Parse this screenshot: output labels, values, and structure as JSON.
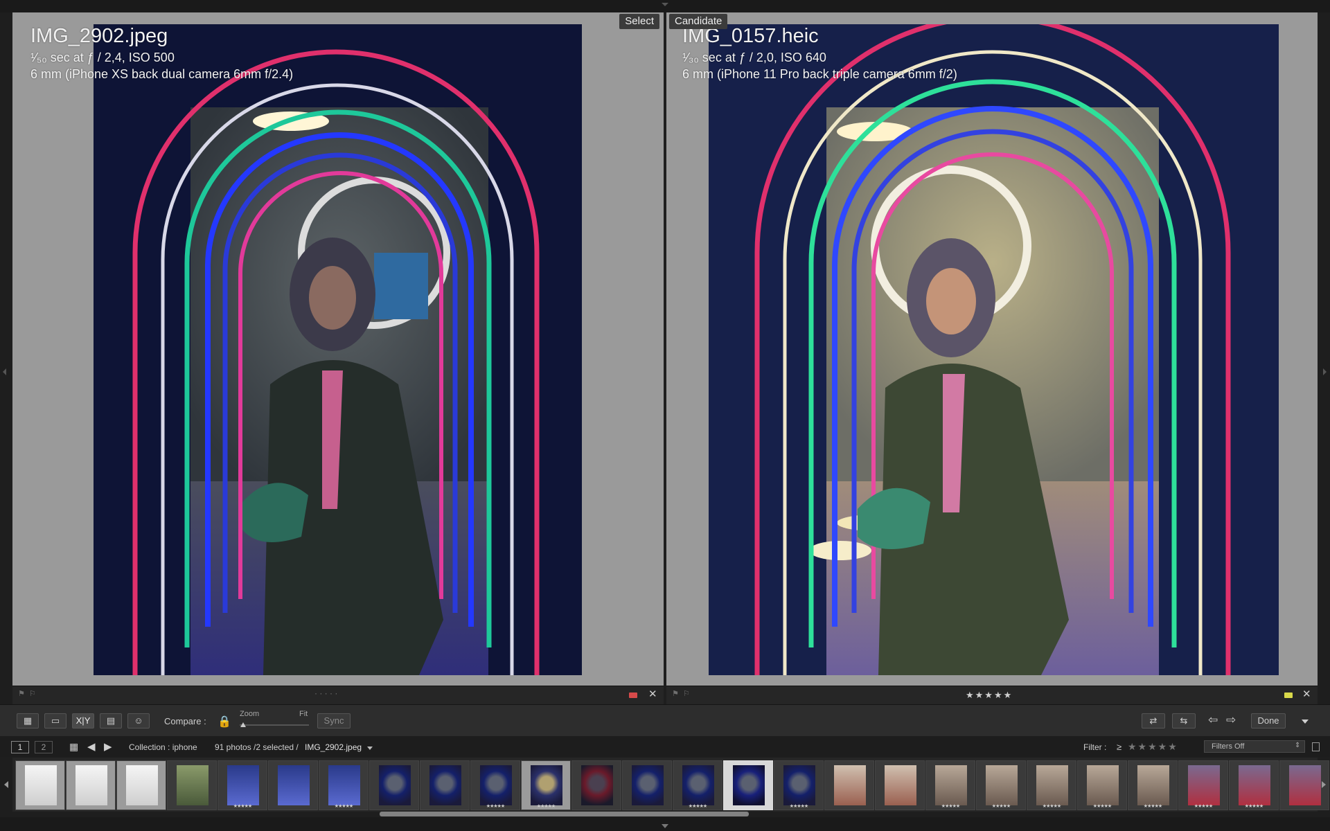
{
  "compare": {
    "left": {
      "tag": "Select",
      "filename": "IMG_2902.jpeg",
      "exposure": "¹⁄₅₀ sec at ƒ / 2,4, ISO 500",
      "lens": "6 mm (iPhone XS back dual camera 6mm f/2.4)",
      "color_label": "#d64a4a"
    },
    "right": {
      "tag": "Candidate",
      "filename": "IMG_0157.heic",
      "exposure": "¹⁄₃₀ sec at ƒ / 2,0, ISO 640",
      "lens": "6 mm (iPhone 11 Pro back triple camera 6mm f/2)",
      "rating": "★★★★★",
      "color_label": "#d8d84a"
    },
    "left_dots": "· · · · ·"
  },
  "toolbar": {
    "compare_label": "Compare :",
    "zoom_label": "Zoom",
    "fit_label": "Fit",
    "sync_label": "Sync",
    "done_label": "Done",
    "xy_label": "X|Y"
  },
  "filmbar": {
    "page1": "1",
    "page2": "2",
    "collection": "Collection : iphone",
    "count": "91 photos /2 selected /",
    "current": "IMG_2902.jpeg",
    "filter_label": "Filter :",
    "filter_op": "≥",
    "filter_stars": "★★★★★",
    "filters_state": "Filters Off"
  },
  "filmstrip": {
    "thumbs": [
      {
        "kind": "bw",
        "stars": ""
      },
      {
        "kind": "bw",
        "stars": ""
      },
      {
        "kind": "bw",
        "stars": ""
      },
      {
        "kind": "green",
        "stars": ""
      },
      {
        "kind": "blue",
        "stars": "★★★★★"
      },
      {
        "kind": "blue",
        "stars": ""
      },
      {
        "kind": "blue",
        "stars": "★★★★★"
      },
      {
        "kind": "arch",
        "stars": ""
      },
      {
        "kind": "arch",
        "stars": ""
      },
      {
        "kind": "arch",
        "stars": "★★★★★"
      },
      {
        "kind": "archwarm",
        "stars": "★★★★★"
      },
      {
        "kind": "archred",
        "stars": ""
      },
      {
        "kind": "arch",
        "stars": ""
      },
      {
        "kind": "arch",
        "stars": "★★★★★"
      },
      {
        "kind": "archsel",
        "stars": ""
      },
      {
        "kind": "arch",
        "stars": "★★★★★"
      },
      {
        "kind": "room",
        "stars": ""
      },
      {
        "kind": "room",
        "stars": ""
      },
      {
        "kind": "hall",
        "stars": "★★★★★"
      },
      {
        "kind": "hall",
        "stars": "★★★★★"
      },
      {
        "kind": "hall",
        "stars": "★★★★★"
      },
      {
        "kind": "hall",
        "stars": "★★★★★"
      },
      {
        "kind": "hall",
        "stars": "★★★★★"
      },
      {
        "kind": "party",
        "stars": "★★★★★"
      },
      {
        "kind": "party",
        "stars": "★★★★★"
      },
      {
        "kind": "party",
        "stars": ""
      }
    ]
  }
}
